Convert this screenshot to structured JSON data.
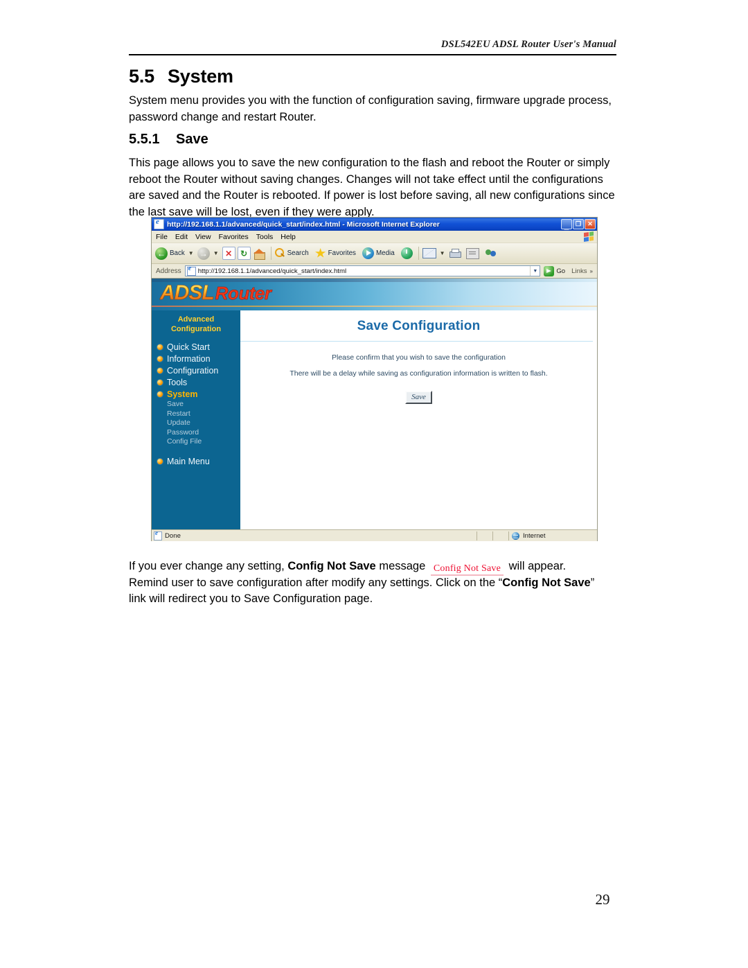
{
  "document": {
    "running_header": "DSL542EU ADSL Router User's Manual",
    "page_number": "29",
    "section": {
      "number": "5.5",
      "title": "System",
      "intro": "System menu provides you with the function of configuration saving, firmware upgrade process, password change and restart Router."
    },
    "subsection": {
      "number": "5.5.1",
      "title": "Save",
      "body": "This page allows you to save the new configuration to the flash and reboot the Router or simply reboot the Router without saving changes. Changes will not take effect until the configurations are saved and the Router is rebooted. If power is lost before saving, all new configurations since the last save will be lost, even if they were apply."
    },
    "closing": {
      "line1_a": "If you ever change any setting, ",
      "line1_bold": "Config Not Save",
      "line1_b": " message ",
      "badge": "Config Not Save",
      "line1_c": " will appear.",
      "line2_a": "Remind user to save configuration after modify any settings. Click on the “",
      "line2_bold": "Config Not Save",
      "line2_b": "”",
      "line3": "link will redirect you to Save Configuration page."
    }
  },
  "browser": {
    "title": "http://192.168.1.1/advanced/quick_start/index.html - Microsoft Internet Explorer",
    "window_buttons": {
      "minimize": "_",
      "maximize": "❐",
      "close": "✕"
    },
    "menu": [
      "File",
      "Edit",
      "View",
      "Favorites",
      "Tools",
      "Help"
    ],
    "toolbar": {
      "back": "Back",
      "forward": "",
      "stop": "✕",
      "refresh": "↻",
      "home": "",
      "search": "Search",
      "favorites": "Favorites",
      "media": "Media",
      "history": "",
      "mail": "",
      "print": "",
      "edit": "",
      "messenger": ""
    },
    "address": {
      "label": "Address",
      "url": "http://192.168.1.1/advanced/quick_start/index.html",
      "dropdown_caret": "▼",
      "go_label": "Go",
      "links_label": "Links",
      "links_chevron": "»"
    },
    "status": {
      "text": "Done",
      "zone": "Internet"
    }
  },
  "router_ui": {
    "logo": {
      "part1": "ADSL",
      "part2": "Router"
    },
    "sidebar": {
      "heading_line1": "Advanced",
      "heading_line2": "Configuration",
      "items": [
        {
          "label": "Quick Start",
          "active": false
        },
        {
          "label": "Information",
          "active": false
        },
        {
          "label": "Configuration",
          "active": false
        },
        {
          "label": "Tools",
          "active": false
        },
        {
          "label": "System",
          "active": true
        }
      ],
      "sub_items": [
        "Save",
        "Restart",
        "Update",
        "Password",
        "Config File"
      ],
      "main_menu": "Main Menu"
    },
    "content": {
      "title": "Save Configuration",
      "confirm_text": "Please confirm that you wish to save the configuration",
      "flash_text": "There will be a delay while saving as configuration information is written to flash.",
      "save_button": "Save"
    }
  },
  "colors": {
    "sidebar_blue": "#0c6591",
    "accent_gold": "#ffcf2e",
    "active_orange": "#ffb400",
    "title_blue": "#1b6aa8",
    "badge_red": "#ee1133"
  }
}
